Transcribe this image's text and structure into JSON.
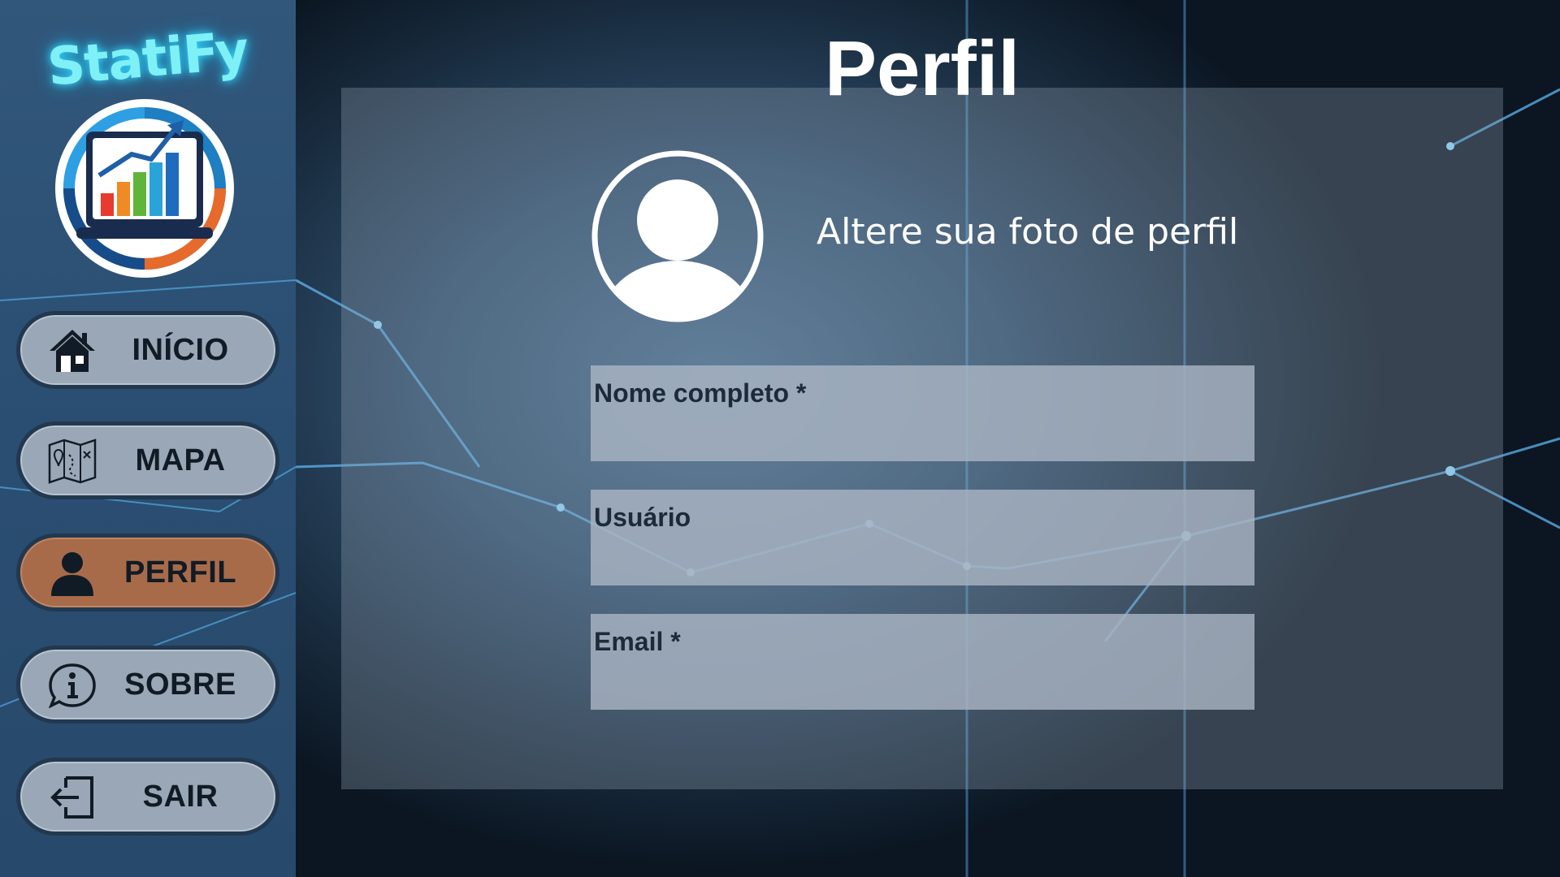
{
  "app": {
    "name": "StatiFy"
  },
  "sidebar": {
    "items": [
      {
        "label": "INÍCIO",
        "icon": "home-icon",
        "active": false
      },
      {
        "label": "MAPA",
        "icon": "map-icon",
        "active": false
      },
      {
        "label": "PERFIL",
        "icon": "user-icon",
        "active": true
      },
      {
        "label": "SOBRE",
        "icon": "info-icon",
        "active": false
      },
      {
        "label": "SAIR",
        "icon": "logout-icon",
        "active": false
      }
    ]
  },
  "main": {
    "title": "Perfil",
    "avatar_prompt": "Altere sua foto de perfil",
    "fields": [
      {
        "label": "Nome completo *",
        "value": ""
      },
      {
        "label": "Usuário",
        "value": ""
      },
      {
        "label": "Email *",
        "value": ""
      }
    ]
  },
  "colors": {
    "accent_active": "#a86b4a",
    "nav_button": "#9aa7b6",
    "sidebar": "#2a4e72",
    "brand_glow": "#7ff1f6"
  }
}
